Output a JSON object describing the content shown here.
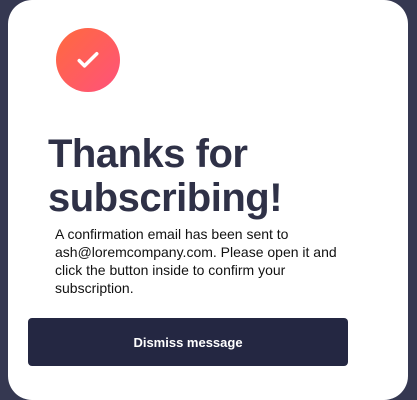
{
  "dialog": {
    "title": "Thanks for subscribing!",
    "message": "A confirmation email has been sent to ash@loremcompany.com. Please open it and click the button inside to confirm your subscription.",
    "dismiss_label": "Dismiss message",
    "icon": "checkmark-icon"
  },
  "colors": {
    "page_background": "#353851",
    "card_background": "#ffffff",
    "title_text": "#2f3147",
    "button_background": "#242742",
    "button_text": "#ffffff",
    "icon_gradient_start": "#ff6a3d",
    "icon_gradient_end": "#ff527b"
  }
}
